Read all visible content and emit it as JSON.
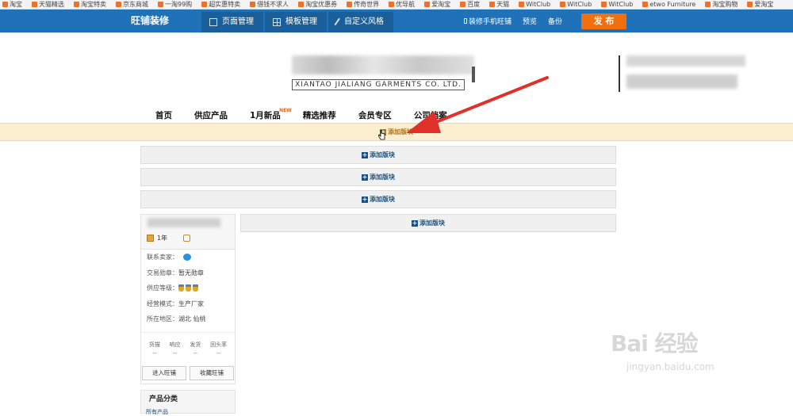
{
  "bookmarks": [
    "淘宝",
    "天猫精选",
    "淘宝特卖",
    "京东商城",
    "一淘99购",
    "超实惠特卖",
    "借钱不求人",
    "淘宝优惠券",
    "传奇世界",
    "优导航",
    "爱淘宝",
    "百度",
    "天猫",
    "WitClub",
    "WitClub",
    "WitClub",
    "etwo Furniture",
    "淘宝购物",
    "爱淘宝"
  ],
  "topbar": {
    "brand": "旺铺装修",
    "tabs": [
      "页面管理",
      "模板管理",
      "自定义风格"
    ],
    "mobile_link": "装修手机旺铺",
    "preview": "预览",
    "backup": "备份",
    "publish": "发 布"
  },
  "shop": {
    "logo_en": "XIANTAO JIALIANG GARMENTS CO. LTD."
  },
  "shop_nav": {
    "items": [
      "首页",
      "供应产品",
      "1月新品",
      "精选推荐",
      "会员专区",
      "公司档案"
    ],
    "new_badge": "NEW"
  },
  "add_module": {
    "label": "添加版块"
  },
  "sidebar": {
    "years": "1年",
    "contact_label": "联系卖家：",
    "medal_label": "交易勋章：",
    "medal_value": "暂无勋章",
    "level_label": "供应等级：",
    "mode_label": "经营模式：",
    "mode_value": "生产厂家",
    "region_label": "所在地区：",
    "region_value": "湖北 仙桃",
    "stats": [
      {
        "label": "货描",
        "value": "--"
      },
      {
        "label": "响应",
        "value": "--"
      },
      {
        "label": "发货",
        "value": "--"
      },
      {
        "label": "回头率",
        "value": "--"
      }
    ],
    "enter_shop": "进入旺铺",
    "fav_shop": "收藏旺铺",
    "category_title": "产品分类",
    "category_item": "所有产品"
  },
  "watermark": {
    "logo": "Bai 经验",
    "url": "jingyan.baidu.com"
  },
  "colors": {
    "topbar": "#1f72b8",
    "publish": "#f07010",
    "highlight_bar": "#fcefcf",
    "arrow": "#e0302a"
  }
}
